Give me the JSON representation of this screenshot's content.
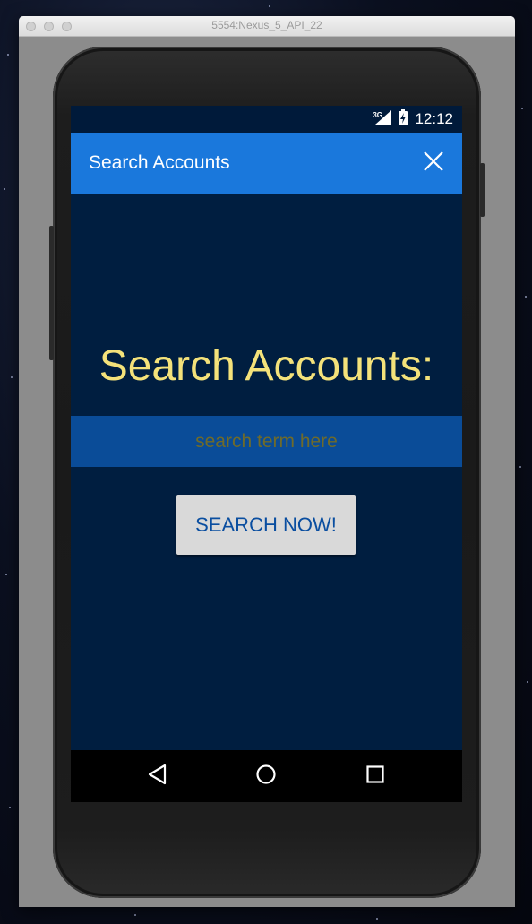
{
  "window": {
    "title": "5554:Nexus_5_API_22"
  },
  "statusbar": {
    "network": "3G",
    "time": "12:12"
  },
  "appbar": {
    "title": "Search Accounts",
    "close_icon": "close-icon"
  },
  "main": {
    "heading": "Search Accounts:",
    "search": {
      "value": "",
      "placeholder": "search term here"
    },
    "button_label": "SEARCH NOW!"
  },
  "navbar": {
    "back_icon": "back-triangle-icon",
    "home_icon": "home-circle-icon",
    "recents_icon": "recents-square-icon"
  },
  "colors": {
    "screen_background": "#001e40",
    "appbar": "#1a78dc",
    "heading_text": "#f4e27a",
    "search_bar": "#0a4c98",
    "placeholder_text": "#6f6b2a",
    "button_background": "#d9d9d9",
    "button_text": "#0a4ea0"
  }
}
